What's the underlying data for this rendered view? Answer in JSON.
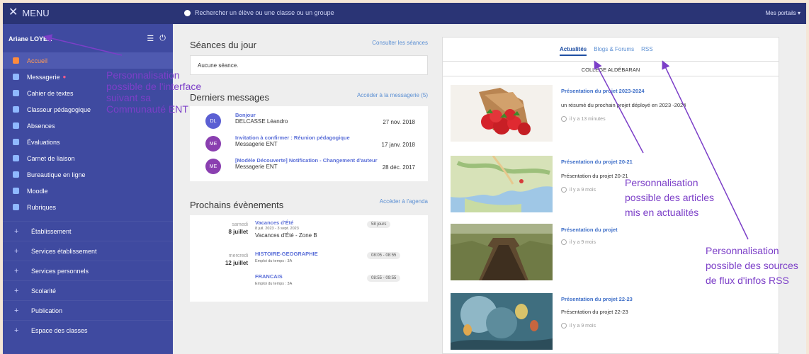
{
  "topbar": {
    "menu_label": "MENU",
    "search_placeholder": "Rechercher un élève ou une classe ou un groupe",
    "portals_label": "Mes portails ▾"
  },
  "user": {
    "name": "Ariane LOYER"
  },
  "sidebar": {
    "items": [
      {
        "label": "Accueil",
        "icon": "home-icon"
      },
      {
        "label": "Messagerie",
        "icon": "mail-icon",
        "badge": "●"
      },
      {
        "label": "Cahier de textes",
        "icon": "book-icon"
      },
      {
        "label": "Classeur pédagogique",
        "icon": "folder-icon"
      },
      {
        "label": "Absences",
        "icon": "person-icon"
      },
      {
        "label": "Évaluations",
        "icon": "chart-icon"
      },
      {
        "label": "Carnet de liaison",
        "icon": "link-icon"
      },
      {
        "label": "Bureautique en ligne",
        "icon": "document-icon"
      },
      {
        "label": "Moodle",
        "icon": "moodle-icon"
      },
      {
        "label": "Rubriques",
        "icon": "bookmark-icon"
      }
    ],
    "sections": [
      "Établissement",
      "Services établissement",
      "Services personnels",
      "Scolarité",
      "Publication",
      "Espace des classes"
    ]
  },
  "annotation_left": "Personnalisation possible de l'interface suivant sa Communauté ENT",
  "seances": {
    "title": "Séances du jour",
    "link": "Consulter les séances",
    "empty": "Aucune séance."
  },
  "messages": {
    "title": "Derniers messages",
    "link": "Accéder à la messagerie (5)",
    "items": [
      {
        "initials": "DL",
        "title": "Bonjour",
        "sender": "DELCASSE Léandro",
        "date": "27 nov. 2018"
      },
      {
        "initials": "ME",
        "title": "Invitation à confirmer : Réunion pédagogique",
        "sender": "Messagerie ENT",
        "date": "17 janv. 2018"
      },
      {
        "initials": "ME",
        "title": "[Modèle Découverte] Notification - Changement d'auteur",
        "sender": "Messagerie ENT",
        "date": "28 déc. 2017"
      }
    ]
  },
  "events": {
    "title": "Prochains évènements",
    "link": "Accéder à l'agenda",
    "groups": [
      {
        "day": "samedi",
        "date": "8 juillet",
        "title": "Vacances d'Été",
        "sub": "8 juil. 2023 - 3 sept. 2023",
        "sub2": "Vacances d'Été - Zone B",
        "pill": "58 jours"
      },
      {
        "day": "mercredi",
        "date": "12 juillet",
        "title": "HISTOIRE-GEOGRAPHIE",
        "sub": "Emploi du temps : 3A",
        "pill": "08:05 - 08:55"
      },
      {
        "title": "FRANCAIS",
        "sub": "Emploi du temps : 3A",
        "pill": "08:55 - 09:55"
      }
    ]
  },
  "news": {
    "tabs": [
      "Actualités",
      "Blogs & Forums",
      "RSS"
    ],
    "school": "COLLÈGE ALDÉBARAN",
    "articles": [
      {
        "title": "Présentation du projet 2023-2024",
        "desc": "un résumé du prochain projet déployé en 2023 -2024",
        "time": "il y a 13 minutes"
      },
      {
        "title": "Présentation du projet 20-21",
        "desc": "Présentation du projet 20-21",
        "time": "il y a 9 mois"
      },
      {
        "title": "Présentation du projet",
        "desc": "",
        "time": "il y a 9 mois"
      },
      {
        "title": "Présentation du projet 22-23",
        "desc": "Présentation du projet 22-23",
        "time": "il y a 9 mois"
      }
    ]
  },
  "annotations": {
    "articles": "Personnalisation possible des articles mis en actualités",
    "rss": "Personnalisation possible des sources de flux d'infos RSS"
  }
}
